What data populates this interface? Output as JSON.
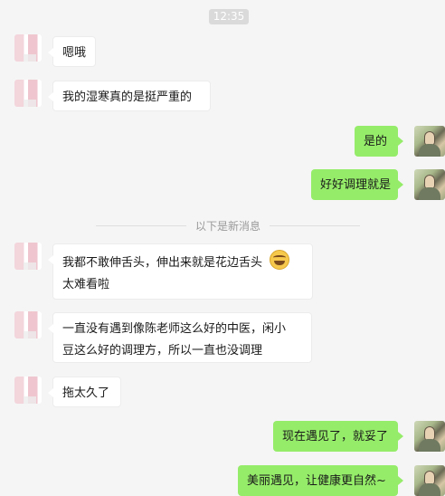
{
  "chat": {
    "time": "12:35",
    "divider_text": "以下是新消息",
    "messages": [
      {
        "side": "left",
        "text": "嗯哦"
      },
      {
        "side": "left",
        "text": "我的湿寒真的是挺严重的"
      },
      {
        "side": "right",
        "text": "是的"
      },
      {
        "side": "right",
        "text": "好好调理就是"
      },
      {
        "side": "left",
        "lines": [
          "我都不敢伸舌头，伸出来就是花边舌头",
          "太难看啦"
        ],
        "emoji": "laugh-tears"
      },
      {
        "side": "left",
        "lines": [
          "一直没有遇到像陈老师这么好的中医，闲小",
          "豆这么好的调理方，所以一直也没调理"
        ]
      },
      {
        "side": "left",
        "text": "拖太久了"
      },
      {
        "side": "right",
        "text": "现在遇见了，就妥了"
      },
      {
        "side": "right",
        "text": "美丽遇见，让健康更自然~"
      }
    ]
  },
  "colors": {
    "background": "#f5f5f5",
    "incoming_bubble": "#ffffff",
    "outgoing_bubble": "#95ec69"
  }
}
